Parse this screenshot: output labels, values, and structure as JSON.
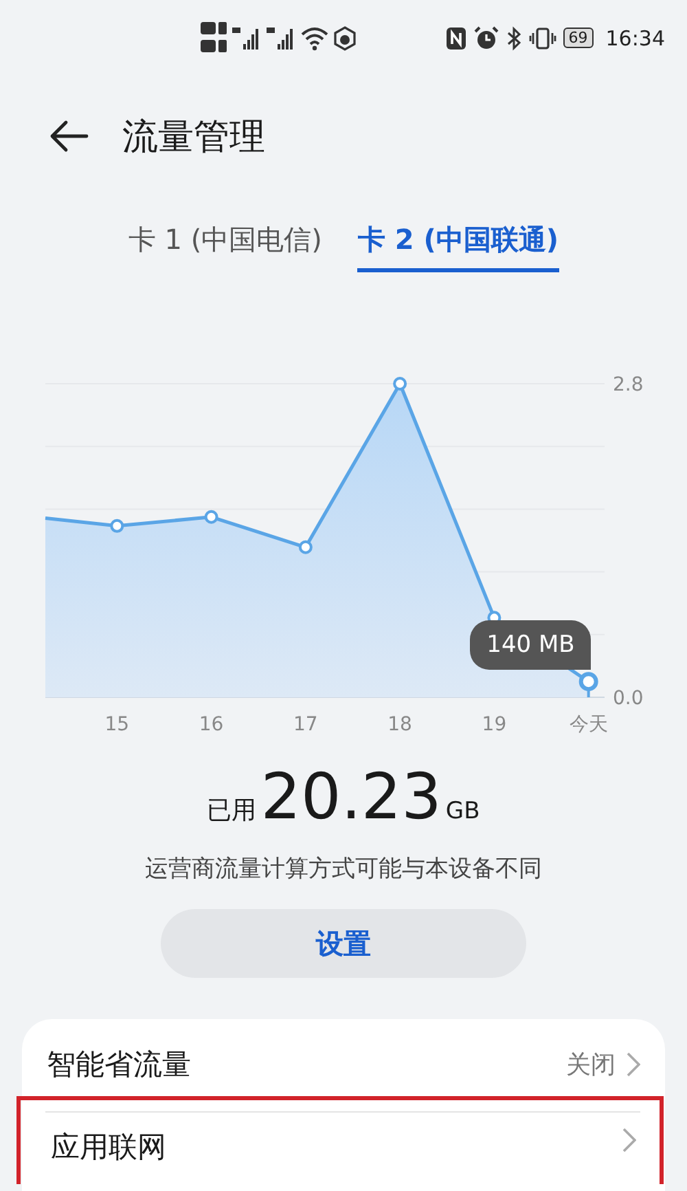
{
  "status_bar": {
    "battery": "69",
    "time": "16:34"
  },
  "header": {
    "title": "流量管理"
  },
  "tabs": [
    {
      "label": "卡 1 (中国电信)",
      "selected": false
    },
    {
      "label": "卡 2 (中国联通)",
      "selected": true
    }
  ],
  "usage_chart": {
    "tooltip": "140 MB",
    "chart_data": {
      "type": "area",
      "x": [
        14.24,
        15,
        16,
        17,
        18,
        19,
        20
      ],
      "series": [
        {
          "color": "#5aa5e6",
          "values": [
            1.6,
            1.53,
            1.61,
            1.34,
            2.8,
            0.71,
            0.14
          ]
        }
      ],
      "xlim": [
        14.24,
        20.17
      ],
      "ylim": [
        0,
        2.8
      ],
      "xticks": [
        {
          "value": 15,
          "label": "15"
        },
        {
          "value": 16,
          "label": "16"
        },
        {
          "value": 17,
          "label": "17"
        },
        {
          "value": 18,
          "label": "18"
        },
        {
          "value": 19,
          "label": "19"
        },
        {
          "value": 20,
          "label": "今天"
        }
      ],
      "yticks": [
        {
          "value": 0,
          "label": "0.0"
        },
        {
          "value": 2.8,
          "label": "2.8"
        }
      ]
    }
  },
  "usage": {
    "prefix": "已用",
    "amount": "20.23",
    "unit": "GB"
  },
  "note": "运营商流量计算方式可能与本设备不同",
  "settings_button": "设置",
  "settings_list": [
    {
      "label": "智能省流量",
      "value": "关闭",
      "highlighted": false
    },
    {
      "label": "应用联网",
      "highlighted": true
    }
  ]
}
